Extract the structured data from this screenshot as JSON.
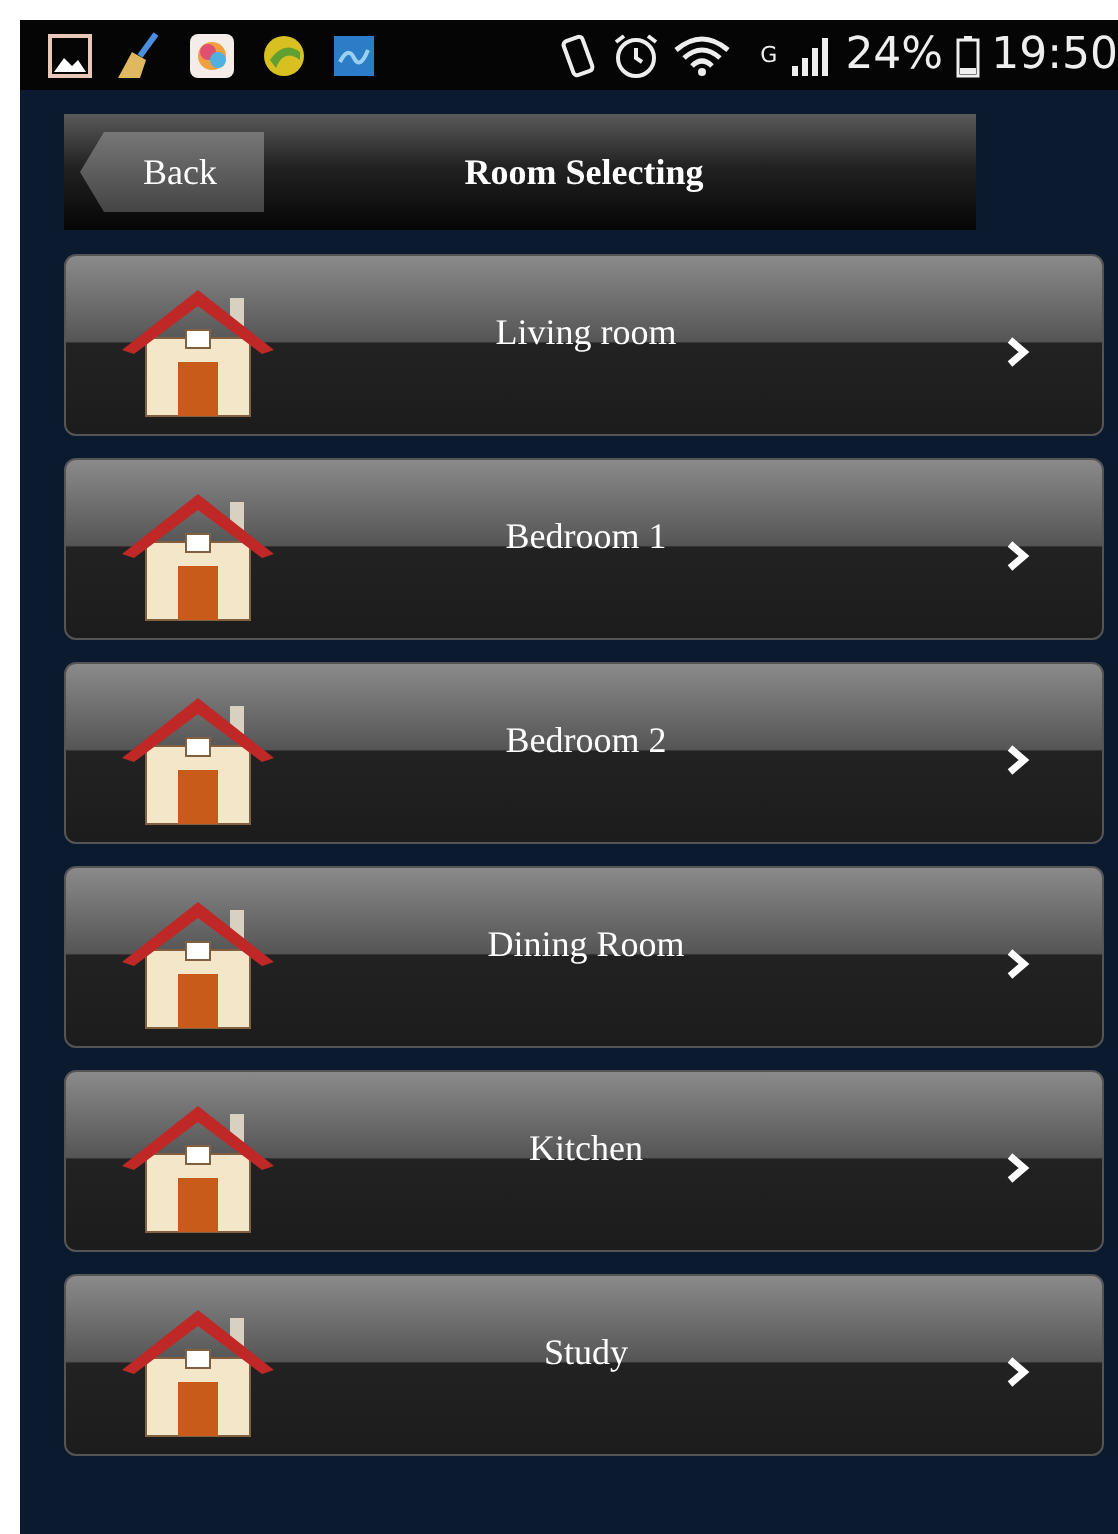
{
  "status_bar": {
    "network": "G",
    "battery": "24%",
    "time": "19:50"
  },
  "header": {
    "back": "Back",
    "title": "Room Selecting"
  },
  "rooms": [
    {
      "name": "Living room"
    },
    {
      "name": "Bedroom 1"
    },
    {
      "name": "Bedroom 2"
    },
    {
      "name": "Dining Room"
    },
    {
      "name": "Kitchen"
    },
    {
      "name": "Study"
    }
  ]
}
